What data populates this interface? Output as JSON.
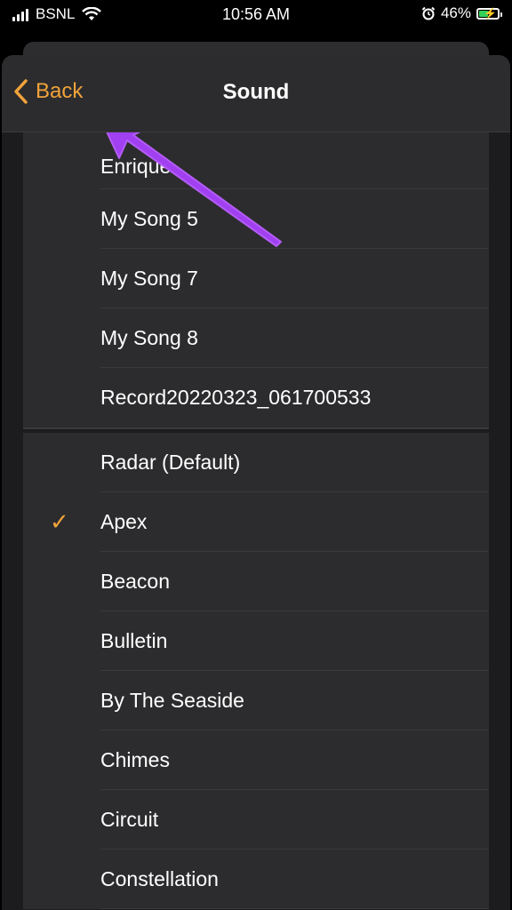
{
  "status_bar": {
    "carrier": "BSNL",
    "time": "10:56 AM",
    "battery_percent": "46%"
  },
  "nav": {
    "back_label": "Back",
    "title": "Sound"
  },
  "custom_sounds": [
    "Enrique",
    "My Song 5",
    "My Song 7",
    "My Song 8",
    "Record20220323_061700533"
  ],
  "ringtones": [
    "Radar (Default)",
    "Apex",
    "Beacon",
    "Bulletin",
    "By The Seaside",
    "Chimes",
    "Circuit",
    "Constellation"
  ],
  "selected_ringtone": "Apex",
  "colors": {
    "accent": "#f2a33a",
    "annotation_arrow": "#a040f0"
  }
}
